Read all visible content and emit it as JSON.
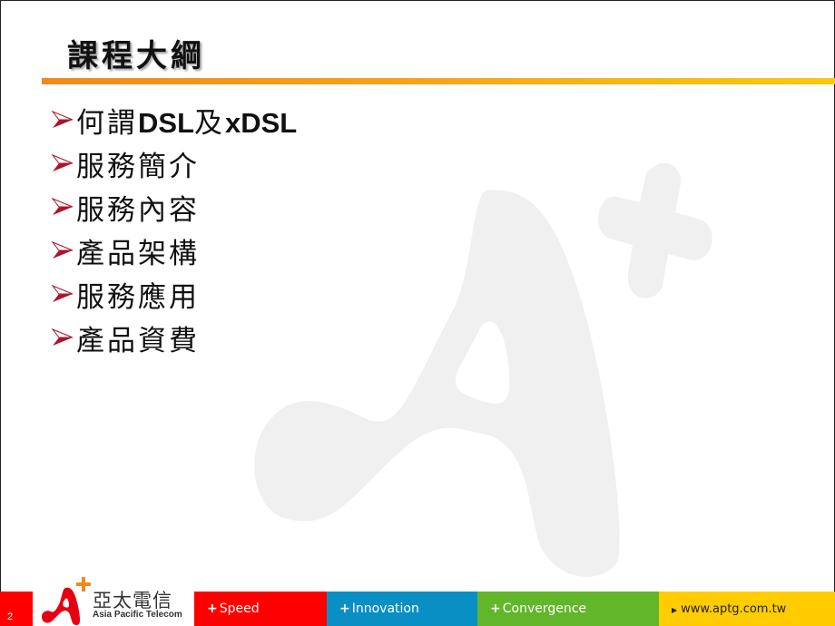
{
  "slide": {
    "title": "課程大綱",
    "page_number": "2",
    "bullets": [
      {
        "parts": [
          {
            "text": "何謂",
            "latin": false
          },
          {
            "text": "DSL",
            "latin": true
          },
          {
            "text": "及",
            "latin": false
          },
          {
            "text": "xDSL",
            "latin": true
          }
        ]
      },
      {
        "parts": [
          {
            "text": "服務簡介",
            "latin": false
          }
        ]
      },
      {
        "parts": [
          {
            "text": "服務內容",
            "latin": false
          }
        ]
      },
      {
        "parts": [
          {
            "text": "產品架構",
            "latin": false
          }
        ]
      },
      {
        "parts": [
          {
            "text": "服務應用",
            "latin": false
          }
        ]
      },
      {
        "parts": [
          {
            "text": "產品資費",
            "latin": false
          }
        ]
      }
    ],
    "bullet_icon": "arrowhead-icon",
    "watermark_icon": "a-plus-logo-icon"
  },
  "footer": {
    "brand_zh": "亞太電信",
    "brand_en": "Asia Pacific Telecom",
    "segments": [
      {
        "label": "Speed",
        "prefix": "+",
        "color": "#ff0000"
      },
      {
        "label": "Innovation",
        "prefix": "+",
        "color": "#0a8fc4"
      },
      {
        "label": "Convergence",
        "prefix": "+",
        "color": "#62b62a"
      }
    ],
    "url": "www.aptg.com.tw",
    "url_color": "#ffcc00"
  },
  "colors": {
    "accent_orange": "#f08a1c",
    "accent_yellow": "#fcc80e",
    "bullet_red": "#b0122a",
    "watermark_gray": "#f0f0f0"
  }
}
